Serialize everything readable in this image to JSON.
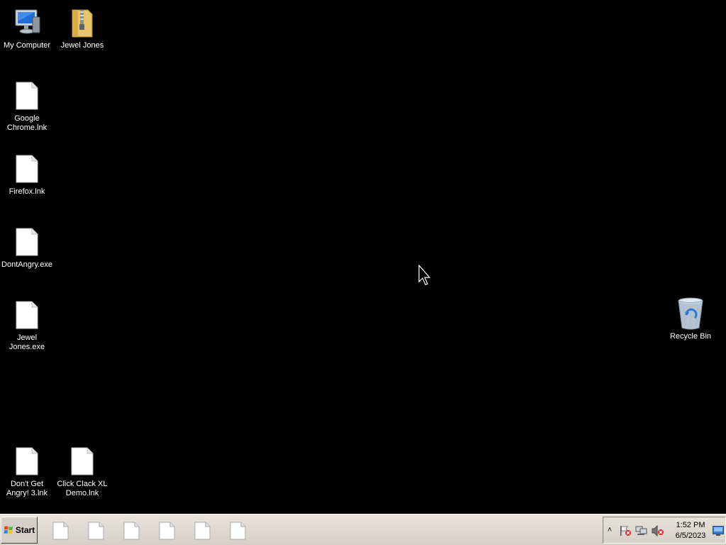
{
  "desktop": {
    "background": "#000000",
    "icons": {
      "my_computer": {
        "label": "My Computer",
        "icon": "computer-icon"
      },
      "jewel_jones_folder": {
        "label": "Jewel Jones",
        "icon": "zip-folder-icon"
      },
      "chrome": {
        "label": "Google\nChrome.lnk",
        "icon": "file-icon"
      },
      "firefox": {
        "label": "Firefox.lnk",
        "icon": "file-icon"
      },
      "dontangry": {
        "label": "DontAngry.exe",
        "icon": "file-icon"
      },
      "jewel_jones_exe": {
        "label": "Jewel\nJones.exe",
        "icon": "file-icon"
      },
      "dont_get_angry": {
        "label": "Don't Get\nAngry! 3.lnk",
        "icon": "file-icon"
      },
      "click_clack": {
        "label": "Click Clack XL\nDemo.lnk",
        "icon": "file-icon"
      },
      "recycle_bin": {
        "label": "Recycle Bin",
        "icon": "recycle-bin-icon"
      }
    }
  },
  "taskbar": {
    "start_label": "Start",
    "task_icon_count": 6,
    "tray": {
      "time": "1:52 PM",
      "date": "6/5/2023",
      "icons": [
        "expand-tray-icon",
        "action-center-flag-icon",
        "network-icon",
        "volume-muted-icon",
        "show-desktop-icon"
      ]
    }
  }
}
